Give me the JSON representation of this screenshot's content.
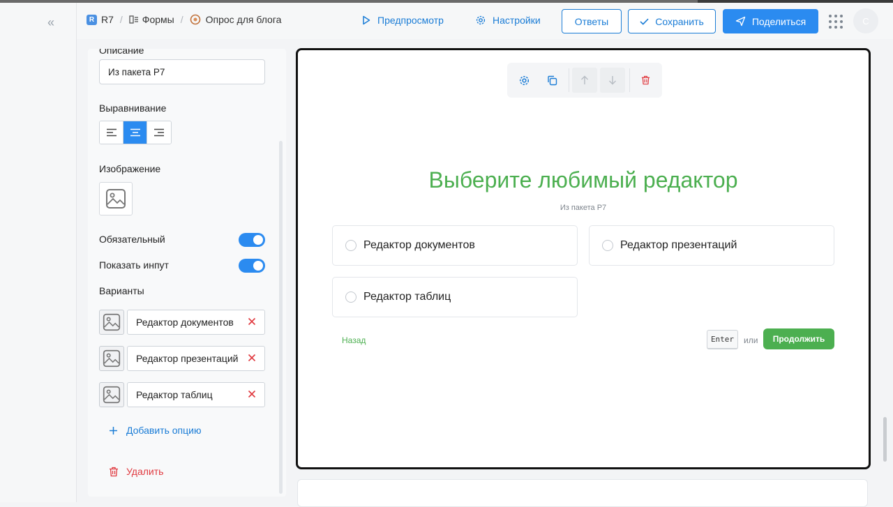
{
  "header": {
    "breadcrumb": {
      "root": "R7",
      "root_badge": "R",
      "forms": "Формы",
      "current": "Опрос для блога"
    },
    "preview_label": "Предпросмотр",
    "settings_label": "Настройки",
    "answers_label": "Ответы",
    "save_label": "Сохранить",
    "share_label": "Поделиться",
    "avatar_initial": "С"
  },
  "panel": {
    "description_label": "Описание",
    "description_value": "Из пакета Р7",
    "alignment_label": "Выравнивание",
    "alignment_selected": "center",
    "image_label": "Изображение",
    "required_label": "Обязательный",
    "required_on": true,
    "show_input_label": "Показать инпут",
    "show_input_on": true,
    "options_label": "Варианты",
    "options": [
      {
        "label": "Редактор документов"
      },
      {
        "label": "Редактор презентаций"
      },
      {
        "label": "Редактор таблиц"
      }
    ],
    "add_option_label": "Добавить опцию",
    "delete_label": "Удалить"
  },
  "question": {
    "title": "Выберите любимый редактор",
    "description": "Из пакета Р7",
    "choices": [
      {
        "label": "Редактор документов"
      },
      {
        "label": "Редактор презентаций"
      },
      {
        "label": "Редактор таблиц"
      }
    ],
    "back_label": "Назад",
    "enter_key": "Enter",
    "or_label": "или",
    "continue_label": "Продолжить"
  },
  "colors": {
    "accent": "#2b8bf0",
    "link": "#1a7cd6",
    "title_green": "#4caf50",
    "danger": "#e0383e"
  }
}
